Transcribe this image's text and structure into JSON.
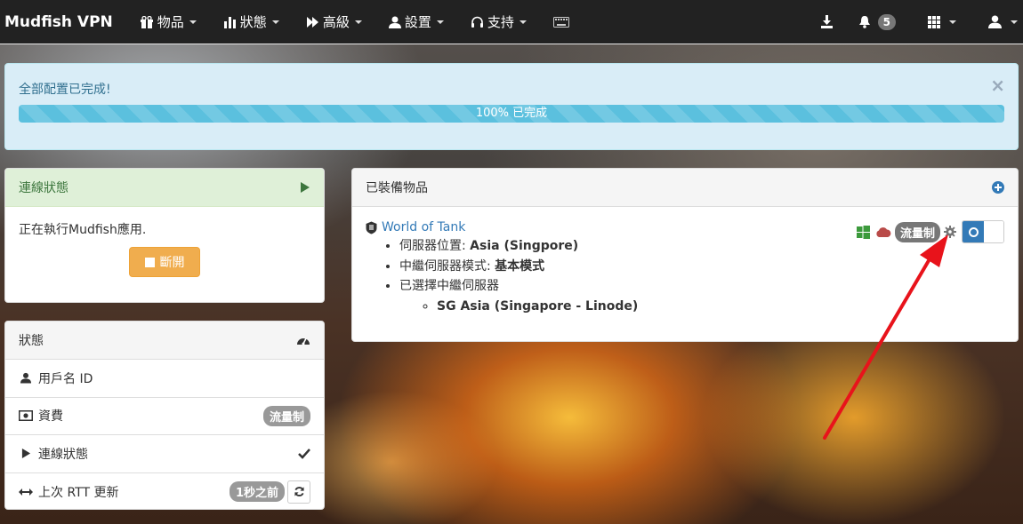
{
  "navbar": {
    "brand": "Mudfish VPN",
    "menus": [
      {
        "label": "物品",
        "icon": "gift-icon"
      },
      {
        "label": "狀態",
        "icon": "bar-chart-icon"
      },
      {
        "label": "高級",
        "icon": "fast-forward-icon"
      },
      {
        "label": "設置",
        "icon": "user-icon"
      },
      {
        "label": "支持",
        "icon": "headphones-icon"
      }
    ],
    "notification_count": "5"
  },
  "alert": {
    "message": "全部配置已完成!",
    "close": "×",
    "progress_text": "100% 已完成",
    "progress_percent": 100
  },
  "connection_panel": {
    "title": "連線狀態",
    "message": "正在執行Mudfish應用.",
    "disconnect_label": "斷開"
  },
  "status_panel": {
    "title": "狀態",
    "rows": [
      {
        "label": "用戶名 ID",
        "icon": "user-icon",
        "value": ""
      },
      {
        "label": "資費",
        "icon": "money-icon",
        "value": "流量制"
      },
      {
        "label": "連線狀態",
        "icon": "play-icon",
        "value": "check-icon"
      },
      {
        "label": "上次 RTT 更新",
        "icon": "resize-horizontal-icon",
        "value": "1秒之前"
      }
    ]
  },
  "equipped_panel": {
    "title": "已裝備物品",
    "item": {
      "name": "World of Tank",
      "details": [
        {
          "label": "伺服器位置: ",
          "value": "Asia (Singpore)"
        },
        {
          "label": "中繼伺服器模式: ",
          "value": "基本模式"
        },
        {
          "label": "已選擇中繼伺服器",
          "value": ""
        }
      ],
      "selected_server": "SG Asia (Singapore - Linode)",
      "billing_label": "流量制"
    }
  },
  "colors": {
    "navbar": "#222222",
    "alert_bg": "#d9edf7",
    "progress": "#5bc0de",
    "success_heading": "#dff0d8",
    "warning_button": "#f0ad4e",
    "toggle_on": "#337ab7",
    "annotation_arrow": "#e8131b"
  }
}
